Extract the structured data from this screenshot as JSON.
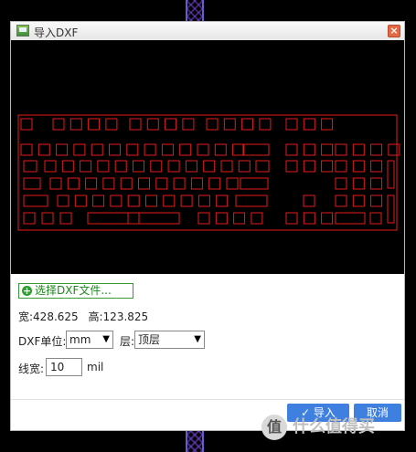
{
  "dialog": {
    "title": "导入DXF",
    "close_glyph": "×"
  },
  "file_button": {
    "label": "选择DXF文件..."
  },
  "dimensions": {
    "width_text": "宽:428.625",
    "height_text": "高:123.825"
  },
  "unit": {
    "label": "DXF单位:",
    "value": "mm"
  },
  "layer": {
    "label": "层:",
    "value": "顶层"
  },
  "line_width": {
    "label": "线宽:",
    "value": "10",
    "unit": "mil"
  },
  "buttons": {
    "import_label": "导入",
    "cancel_label": "取消"
  },
  "watermark": {
    "text": "什么值得买"
  },
  "colors": {
    "outline": "#e31c1c",
    "accent_button": "#3f7fe0",
    "file_button_green": "#2e9e2e"
  },
  "icons": {
    "title": "image-icon",
    "close": "close-icon",
    "file_button": "plus-circle-icon",
    "import_check": "check-icon",
    "dropdown": "triangle-down-icon"
  }
}
